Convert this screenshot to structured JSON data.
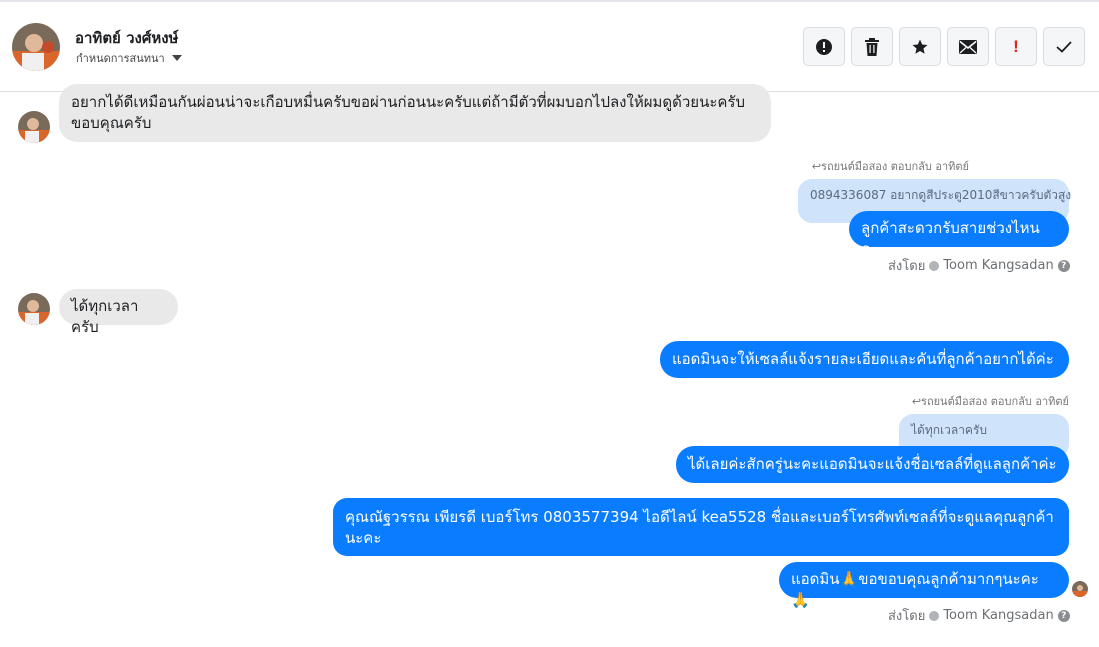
{
  "header": {
    "contact_name": "อาทิตย์ วงศ์หงษ์",
    "assign_label": "กำหนดการสนทนา",
    "actions": [
      {
        "icon": "exclamation-circle-icon"
      },
      {
        "icon": "trash-icon"
      },
      {
        "icon": "star-icon"
      },
      {
        "icon": "envelope-icon"
      },
      {
        "icon": "red-exclamation-icon",
        "text": "!"
      },
      {
        "icon": "checkmark-icon"
      }
    ]
  },
  "messages": {
    "m1": "อยากได้ดีเหมือนกันผ่อนน่าจะเกือบหมื่นครับขอผ่านก่อนนะครับแต่ถ้ามีตัวที่ผมบอกไปลงให้ผมดูด้วยนะครับ ขอบคุณครับ",
    "reply1_meta": "รถยนต์มือสอง ตอบกลับ อาทิตย์",
    "reply1_quote": "0894336087 อยากดูสีประตู2010สีขาวครับตัวสูง",
    "m2": "ลูกค้าสะดวกรับสายช่วงไหนคะ",
    "sent_by_1": "ส่งโดย",
    "sender_1": "Toom Kangsadan",
    "m3": "ได้ทุกเวลาครับ",
    "m4": "แอดมินจะให้เซลล์แจ้งรายละเอียดและคันที่ลูกค้าอยากได้ค่ะ",
    "reply2_meta": "รถยนต์มือสอง ตอบกลับ อาทิตย์",
    "reply2_quote": "ได้ทุกเวลาครับ",
    "m5": "ได้เลยค่ะสักครู่นะคะแอดมินจะแจ้งชื่อเซลล์ที่ดูแลลูกค้าค่ะ",
    "m6": "คุณณัฐวรรณ เพียรดี       เบอร์โทร 0803577394  ไอดีไลน์ kea5528 ชื่อและเบอร์โทรศัพท์เซลล์ที่จะดูแลคุณลูกค้านะคะ",
    "m7": "แอดมิน🙏ขอขอบคุณลูกค้ามากๆนะคะ 🙏",
    "sent_by_2": "ส่งโดย",
    "sender_2": "Toom Kangsadan"
  },
  "colors": {
    "outgoing": "#0a7cff",
    "incoming": "#e9e9e9",
    "quote": "#cfe3fb"
  }
}
